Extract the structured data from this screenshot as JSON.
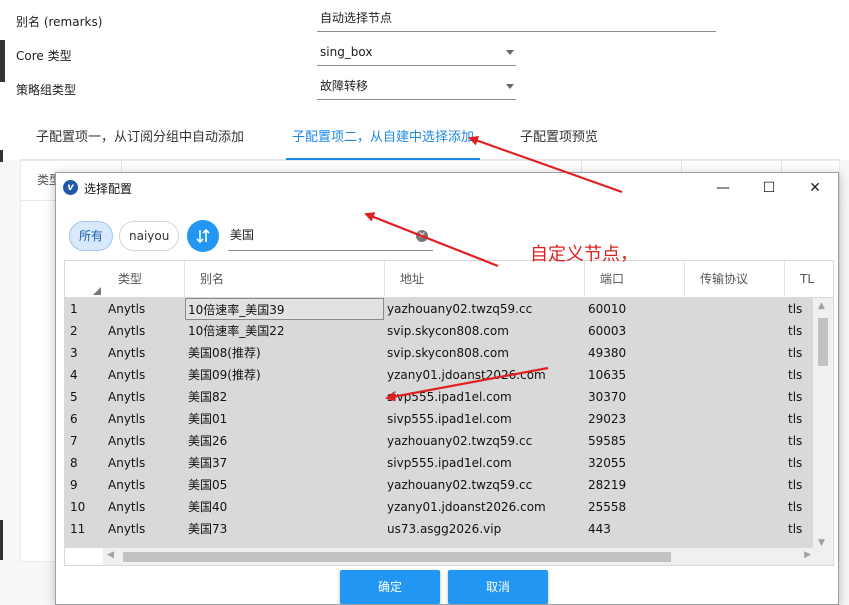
{
  "form": {
    "fields": [
      {
        "label": "别名 (remarks)",
        "value": "自动选择节点"
      },
      {
        "label": "Core 类型",
        "value": "sing_box"
      },
      {
        "label": "策略组类型",
        "value": "故障转移"
      }
    ],
    "tabs": [
      {
        "label": "子配置项一，从订阅分组中自动添加"
      },
      {
        "label": "子配置项二，从自建中选择添加"
      },
      {
        "label": "子配置项预览"
      }
    ],
    "panel_head_first": "类型"
  },
  "dialog": {
    "title": "选择配置",
    "window_buttons": {
      "minimize": "—",
      "maximize": "☐",
      "close": "✕"
    },
    "filters": [
      {
        "label": "所有"
      },
      {
        "label": "naiyou"
      }
    ],
    "search_value": "美国",
    "columns": [
      "类型",
      "别名",
      "地址",
      "端口",
      "传输协议",
      "TL"
    ],
    "rows": [
      {
        "num": "1",
        "type": "Anytls",
        "alias": "10倍速率_美国39",
        "address": "yazhouany02.twzq59.cc",
        "port": "60010",
        "transport": "",
        "tls": "tls"
      },
      {
        "num": "2",
        "type": "Anytls",
        "alias": "10倍速率_美国22",
        "address": "svip.skycon808.com",
        "port": "60003",
        "transport": "",
        "tls": "tls"
      },
      {
        "num": "3",
        "type": "Anytls",
        "alias": "美国08(推荐)",
        "address": "svip.skycon808.com",
        "port": "49380",
        "transport": "",
        "tls": "tls"
      },
      {
        "num": "4",
        "type": "Anytls",
        "alias": "美国09(推荐)",
        "address": "yzany01.jdoanst2026.com",
        "port": "10635",
        "transport": "",
        "tls": "tls"
      },
      {
        "num": "5",
        "type": "Anytls",
        "alias": "美国82",
        "address": "sivp555.ipad1el.com",
        "port": "30370",
        "transport": "",
        "tls": "tls"
      },
      {
        "num": "6",
        "type": "Anytls",
        "alias": "美国01",
        "address": "sivp555.ipad1el.com",
        "port": "29023",
        "transport": "",
        "tls": "tls"
      },
      {
        "num": "7",
        "type": "Anytls",
        "alias": "美国26",
        "address": "yazhouany02.twzq59.cc",
        "port": "59585",
        "transport": "",
        "tls": "tls"
      },
      {
        "num": "8",
        "type": "Anytls",
        "alias": "美国37",
        "address": "sivp555.ipad1el.com",
        "port": "32055",
        "transport": "",
        "tls": "tls"
      },
      {
        "num": "9",
        "type": "Anytls",
        "alias": "美国05",
        "address": "yazhouany02.twzq59.cc",
        "port": "28219",
        "transport": "",
        "tls": "tls"
      },
      {
        "num": "10",
        "type": "Anytls",
        "alias": "美国40",
        "address": "yzany01.jdoanst2026.com",
        "port": "25558",
        "transport": "",
        "tls": "tls"
      },
      {
        "num": "11",
        "type": "Anytls",
        "alias": "美国73",
        "address": "us73.asgg2026.vip",
        "port": "443",
        "transport": "",
        "tls": "tls"
      }
    ],
    "ok_label": "确定",
    "cancel_label": "取消"
  },
  "annotation": {
    "text": "自定义节点，",
    "color": "#e02020"
  }
}
